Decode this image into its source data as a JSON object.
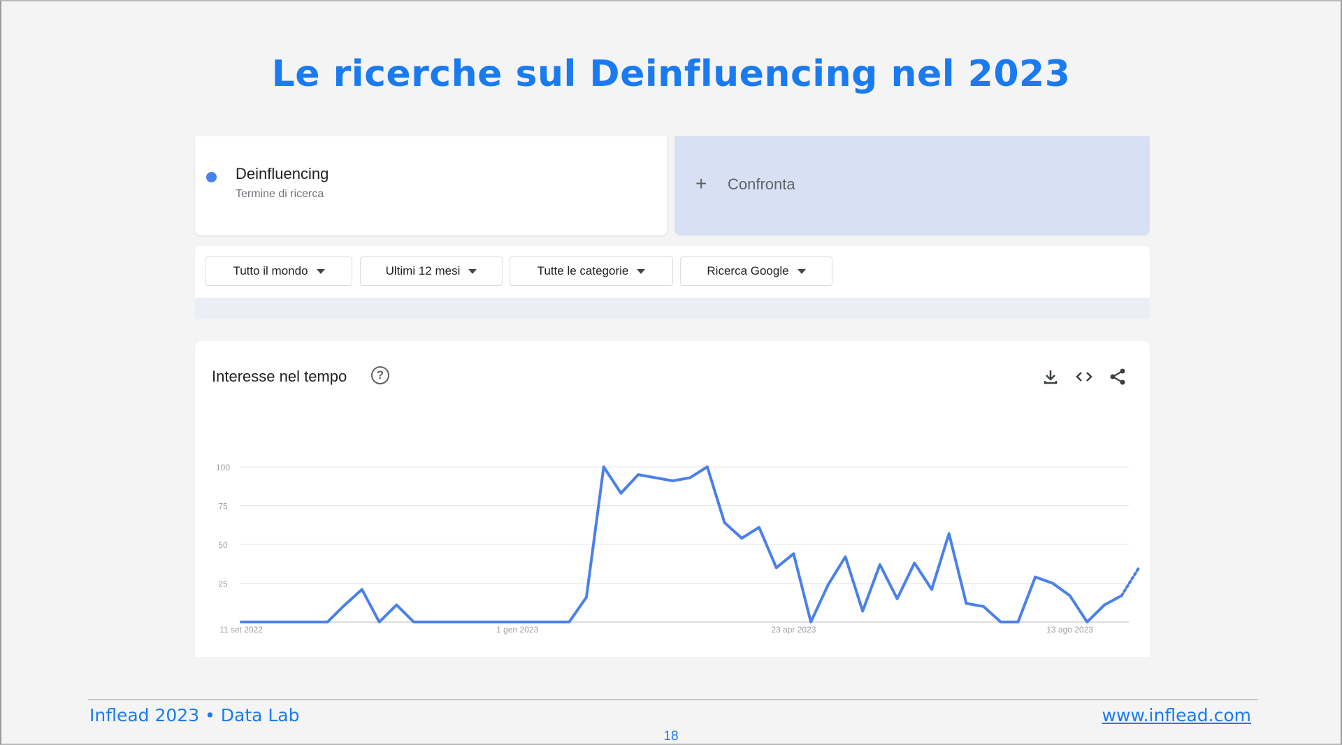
{
  "slide": {
    "title": "Le ricerche sul Deinfluencing nel 2023",
    "footer_left": "Inflead 2023 • Data Lab",
    "footer_right": "www.inflead.com",
    "page_number": "18"
  },
  "search_term": {
    "name": "Deinfluencing",
    "subtitle": "Termine di ricerca",
    "color": "#4a80e9"
  },
  "compare": {
    "label": "Confronta",
    "icon": "plus-icon"
  },
  "filters": [
    {
      "label": "Tutto il mondo"
    },
    {
      "label": "Ultimi 12 mesi"
    },
    {
      "label": "Tutte le categorie"
    },
    {
      "label": "Ricerca Google"
    }
  ],
  "chart_panel": {
    "title": "Interesse nel tempo",
    "help_icon": "help-icon",
    "actions": [
      "download-icon",
      "embed-code-icon",
      "share-icon"
    ]
  },
  "chart_data": {
    "type": "line",
    "title": "Interesse nel tempo",
    "yticks": [
      100,
      75,
      50,
      25
    ],
    "ylim": [
      0,
      100
    ],
    "grid": true,
    "x_tick_labels": [
      "11 set 2022",
      "1 gen 2023",
      "23 apr 2023",
      "13 ago 2023"
    ],
    "x_tick_index": [
      0,
      16,
      32,
      48
    ],
    "series": [
      {
        "name": "Deinfluencing",
        "color": "#4a80e9",
        "values": [
          0,
          0,
          0,
          0,
          0,
          0,
          11,
          21,
          0,
          11,
          0,
          0,
          0,
          0,
          0,
          0,
          0,
          0,
          0,
          0,
          16,
          100,
          83,
          95,
          93,
          91,
          93,
          100,
          64,
          54,
          61,
          35,
          44,
          0,
          24,
          42,
          7,
          37,
          15,
          38,
          21,
          57,
          12,
          10,
          0,
          0,
          29,
          25,
          17,
          0,
          11,
          17
        ],
        "partial_values": [
          17,
          35
        ]
      }
    ]
  },
  "colors": {
    "accent": "#1a7bf0",
    "line": "#4a80e9",
    "compare_bg": "#d8e0f4"
  }
}
